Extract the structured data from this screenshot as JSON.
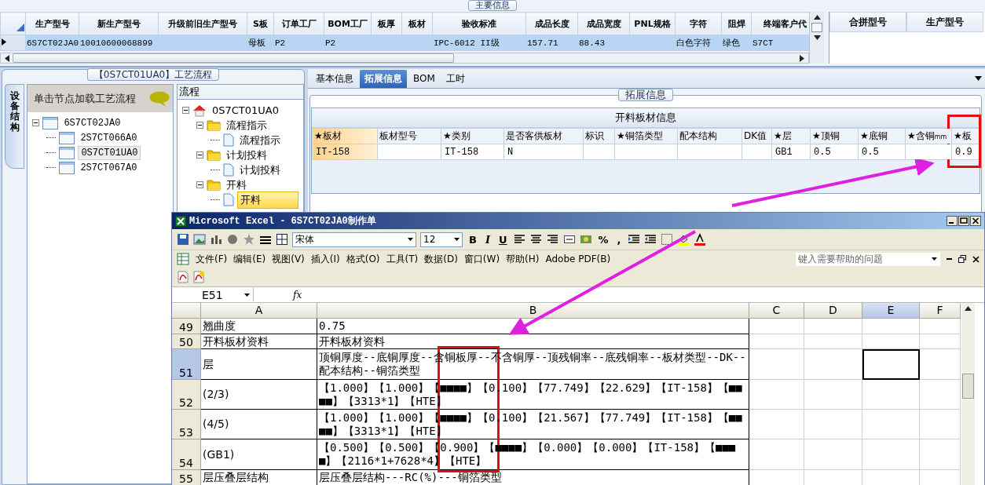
{
  "main_info": {
    "title": "主要信息",
    "columns": [
      "生产型号",
      "新生产型号",
      "升级前旧生产型号",
      "S板",
      "订单工厂",
      "BOM工厂",
      "板厚",
      "板材",
      "验收标准",
      "成品长度",
      "成品宽度",
      "PNL规格",
      "字符",
      "阻焊",
      "终端客户代"
    ],
    "rows": [
      {
        "selected": true,
        "cells": [
          "6S7CT02JA0",
          "10010600068899",
          "",
          "母板",
          "P2",
          "P2",
          "",
          "",
          "IPC-6012 II级",
          "157.71",
          "88.43",
          "",
          "白色字符",
          "绿色",
          "S7CT"
        ]
      }
    ],
    "side_columns": [
      "合拼型号",
      "生产型号"
    ]
  },
  "process_panel": {
    "title": "【0S7CT01UA0】工艺流程",
    "side_tab": "设备结构",
    "hint": "单击节点加载工艺流程",
    "structure_tree": [
      {
        "label": "6S7CT02JA0",
        "selected": false,
        "expanded": true,
        "children": [
          {
            "label": "2S7CT066A0",
            "selected": false
          },
          {
            "label": "0S7CT01UA0",
            "selected": true
          },
          {
            "label": "2S7CT067A0",
            "selected": false
          }
        ]
      }
    ],
    "flow_header": "流程",
    "flow_tree": [
      {
        "label": "0S7CT01UA0",
        "kind": "home",
        "selected": false,
        "expanded": true,
        "children": [
          {
            "label": "流程指示",
            "kind": "folder",
            "selected": false,
            "expanded": true,
            "children": [
              {
                "label": "流程指示",
                "kind": "document",
                "selected": false
              }
            ]
          },
          {
            "label": "计划投料",
            "kind": "folder",
            "selected": false,
            "expanded": true,
            "children": [
              {
                "label": "计划投料",
                "kind": "document",
                "selected": false
              }
            ]
          },
          {
            "label": "开料",
            "kind": "folder",
            "selected": false,
            "expanded": true,
            "children": [
              {
                "label": "开料",
                "kind": "document",
                "selected": true
              }
            ]
          }
        ]
      }
    ]
  },
  "detail": {
    "tabs": [
      {
        "label": "基本信息",
        "selected": false
      },
      {
        "label": "拓展信息",
        "selected": true
      },
      {
        "label": "BOM",
        "selected": false
      },
      {
        "label": "工时",
        "selected": false
      }
    ],
    "group_title": "拓展信息",
    "table": {
      "title": "开料板材信息",
      "columns": [
        {
          "label": "★板材",
          "selected": true
        },
        {
          "label": "板材型号",
          "selected": false
        },
        {
          "label": "★类别",
          "selected": false
        },
        {
          "label": "是否客供板材",
          "selected": false
        },
        {
          "label": "标识",
          "selected": false
        },
        {
          "label": "★铜箔类型",
          "selected": false
        },
        {
          "label": "配本结构",
          "selected": false
        },
        {
          "label": "DK值",
          "selected": false
        },
        {
          "label": "★层",
          "selected": false
        },
        {
          "label": "★顶铜",
          "selected": false
        },
        {
          "label": "★底铜",
          "selected": false
        },
        {
          "label": "★含铜$_{mm}$",
          "selected": false
        },
        {
          "label": "★板",
          "selected": false
        }
      ],
      "rows": [
        {
          "cells": [
            "IT-158",
            "",
            "IT-158",
            "N",
            "",
            "",
            "",
            "",
            "GB1",
            "0.5",
            "0.5",
            "",
            "0.9"
          ]
        }
      ]
    }
  },
  "excel": {
    "title": "Microsoft Excel - 6S7CT02JA0制作单",
    "font": "宋体",
    "font_size": "12",
    "format_buttons": [
      "B",
      "I",
      "U"
    ],
    "number_buttons": [
      "%",
      ","
    ],
    "menus": [
      "文件(F)",
      "编辑(E)",
      "视图(V)",
      "插入(I)",
      "格式(O)",
      "工具(T)",
      "数据(D)",
      "窗口(W)",
      "帮助(H)",
      "Adobe PDF(B)"
    ],
    "help_placeholder": "键入需要帮助的问题",
    "name_box": "E51",
    "formula_label": "fx",
    "columns": [
      {
        "label": "A",
        "selected": false
      },
      {
        "label": "B",
        "selected": false
      },
      {
        "label": "C",
        "selected": false
      },
      {
        "label": "D",
        "selected": false
      },
      {
        "label": "E",
        "selected": true
      },
      {
        "label": "F",
        "selected": false
      }
    ],
    "rows": [
      {
        "number": "49",
        "selected": false,
        "a": "翘曲度",
        "b": "0.75"
      },
      {
        "number": "50",
        "selected": false,
        "a": "开料板材资料",
        "b": "开料板材资料"
      },
      {
        "number": "51",
        "selected": true,
        "a": "层",
        "b": "顶铜厚度--底铜厚度--含铜板厚--不含铜厚--顶残铜率--底残铜率--板材类型--DK--配本结构--铜箔类型"
      },
      {
        "number": "52",
        "selected": false,
        "a": "(2/3)",
        "b": "【1.000】【1.000】【■■■■】【0.100】【77.749】【22.629】【IT-158】【■■■■】【3313*1】【HTE】"
      },
      {
        "number": "53",
        "selected": false,
        "a": "(4/5)",
        "b": "【1.000】【1.000】【■■■■】【0.100】【21.567】【77.749】【IT-158】【■■■■】【3313*1】【HTE】"
      },
      {
        "number": "54",
        "selected": false,
        "a": "(GB1)",
        "b": "【0.500】【0.500】【0.900】【■■■■】【0.000】【0.000】【IT-158】【■■■■】【2116*1+7628*4】【HTE】"
      },
      {
        "number": "55",
        "selected": false,
        "a": "层压叠层结构",
        "b": "层压叠层结构---RC(%)---铜箔类型"
      }
    ]
  }
}
